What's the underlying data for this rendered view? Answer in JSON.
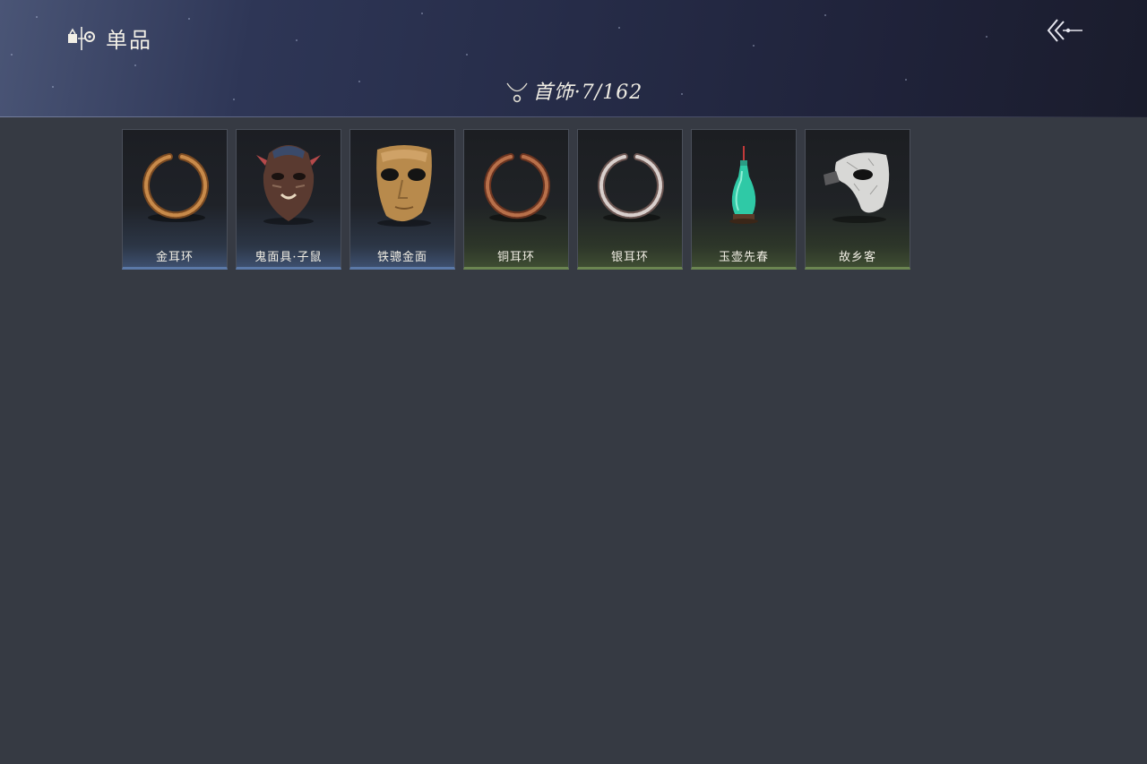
{
  "header": {
    "title": "单品",
    "title_icon": "collection-icon",
    "back_icon": "back-arrow-icon"
  },
  "category": {
    "icon": "necklace-icon",
    "label": "首饰·7/162"
  },
  "items": [
    {
      "name": "金耳环",
      "icon": "gold-earring-icon",
      "rarity": "blue"
    },
    {
      "name": "鬼面具·子鼠",
      "icon": "rat-mask-icon",
      "rarity": "blue"
    },
    {
      "name": "铁骢金面",
      "icon": "gold-mask-icon",
      "rarity": "blue"
    },
    {
      "name": "铜耳环",
      "icon": "copper-earring-icon",
      "rarity": "green"
    },
    {
      "name": "银耳环",
      "icon": "silver-earring-icon",
      "rarity": "green"
    },
    {
      "name": "玉壶先春",
      "icon": "jade-vase-icon",
      "rarity": "green"
    },
    {
      "name": "故乡客",
      "icon": "white-half-mask-icon",
      "rarity": "green"
    }
  ],
  "colors": {
    "background": "#363a43",
    "rarity_blue": "#5b79a8",
    "rarity_green": "#6b8551"
  }
}
